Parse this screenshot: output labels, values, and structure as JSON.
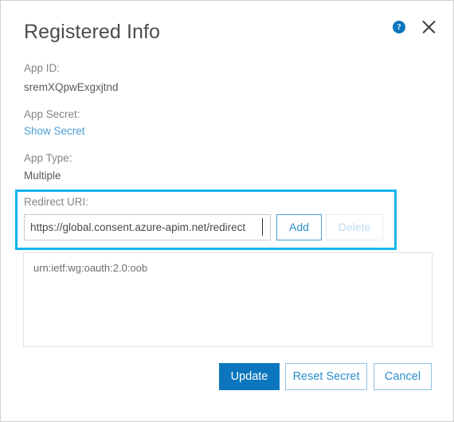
{
  "dialog": {
    "title": "Registered Info",
    "help_icon": "help-circle-icon",
    "close_icon": "close-icon"
  },
  "fields": {
    "app_id_label": "App ID:",
    "app_id_value": "sremXQpwExgxjtnd",
    "app_secret_label": "App Secret:",
    "show_secret_link": "Show Secret",
    "app_type_label": "App Type:",
    "app_type_value": "Multiple"
  },
  "redirect": {
    "label": "Redirect URI:",
    "input_value": "https://global.consent.azure-apim.net/redirect",
    "input_placeholder": "",
    "add_label": "Add",
    "delete_label": "Delete",
    "delete_disabled": true,
    "highlight_color": "#16b4f0",
    "list_items": [
      "urn:ietf:wg:oauth:2.0:oob"
    ]
  },
  "footer": {
    "update_label": "Update",
    "reset_secret_label": "Reset Secret",
    "cancel_label": "Cancel",
    "primary_color": "#0b76bd",
    "link_color": "#2b8fcd"
  }
}
